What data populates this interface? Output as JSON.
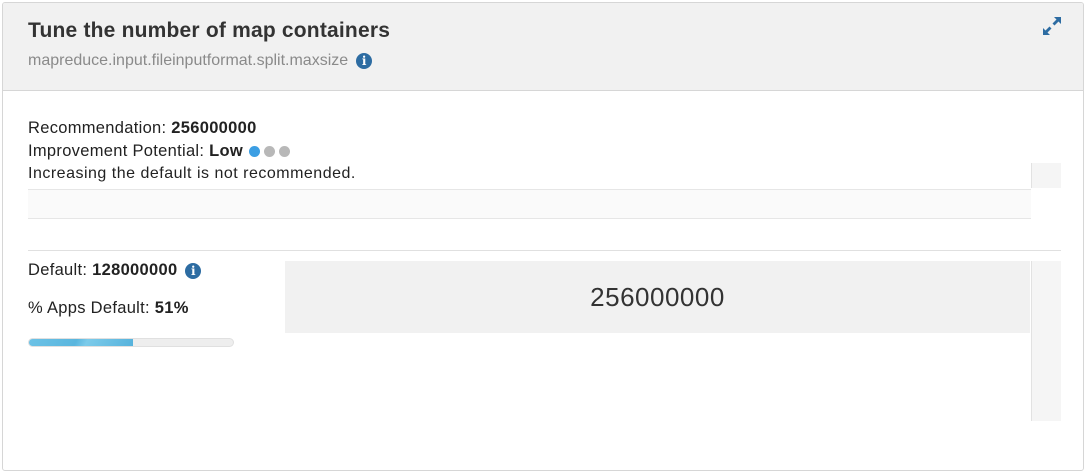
{
  "card": {
    "title": "Tune the number of map containers",
    "property": "mapreduce.input.fileinputformat.split.maxsize",
    "info_glyph": "i",
    "expand_icon": "expand-icon"
  },
  "recommendation": {
    "label": "Recommendation: ",
    "value": "256000000"
  },
  "improvement": {
    "label": "Improvement Potential: ",
    "value": "Low",
    "level": 1,
    "max_level": 3,
    "active_color": "#3b9ee3",
    "inactive_color": "#b8b8b8"
  },
  "description": "Increasing the default is not recommended.",
  "default": {
    "label": "Default: ",
    "value": "128000000",
    "info_glyph": "i"
  },
  "apps_default": {
    "label": "% Apps Default: ",
    "value": "51%",
    "fraction": 0.51
  },
  "recommended_value_display": "256000000",
  "colors": {
    "info_icon": "#2d6ca2",
    "progress": "#5ab6de",
    "header_bg": "#f1f1f1"
  }
}
